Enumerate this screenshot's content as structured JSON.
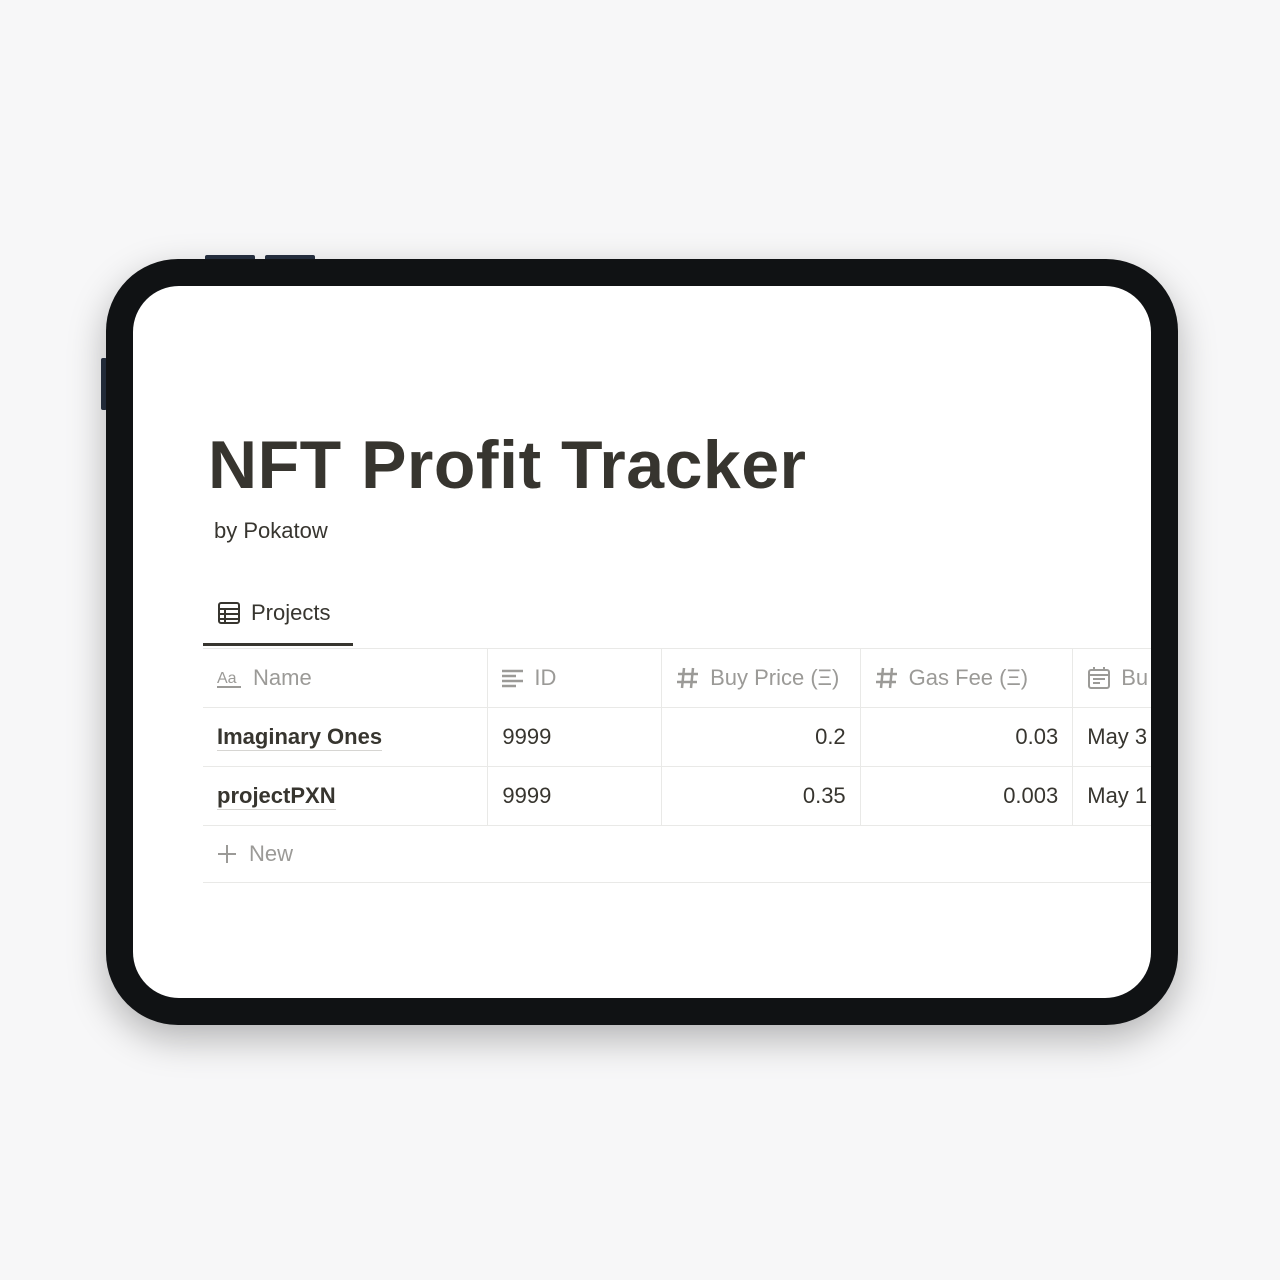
{
  "page": {
    "title": "NFT Profit Tracker",
    "subtitle": "by Pokatow"
  },
  "view_tab": {
    "label": "Projects",
    "icon": "table-icon"
  },
  "table": {
    "columns": [
      {
        "label": "Name",
        "icon": "text-aa-icon"
      },
      {
        "label": "ID",
        "icon": "text-lines-icon"
      },
      {
        "label": "Buy Price (Ξ)",
        "icon": "hash-icon"
      },
      {
        "label": "Gas Fee (Ξ)",
        "icon": "hash-icon"
      },
      {
        "label": "Bu",
        "icon": "calendar-icon"
      }
    ],
    "rows": [
      {
        "name": "Imaginary Ones",
        "id": "9999",
        "buy_price": "0.2",
        "gas_fee": "0.03",
        "date": "May 3"
      },
      {
        "name": "projectPXN",
        "id": "9999",
        "buy_price": "0.35",
        "gas_fee": "0.003",
        "date": "May 1"
      }
    ],
    "new_label": "New"
  },
  "colors": {
    "text": "#37352f",
    "muted": "#9b9a97",
    "border": "#e9e9e7",
    "device_frame": "#101214",
    "background": "#f7f7f8"
  }
}
